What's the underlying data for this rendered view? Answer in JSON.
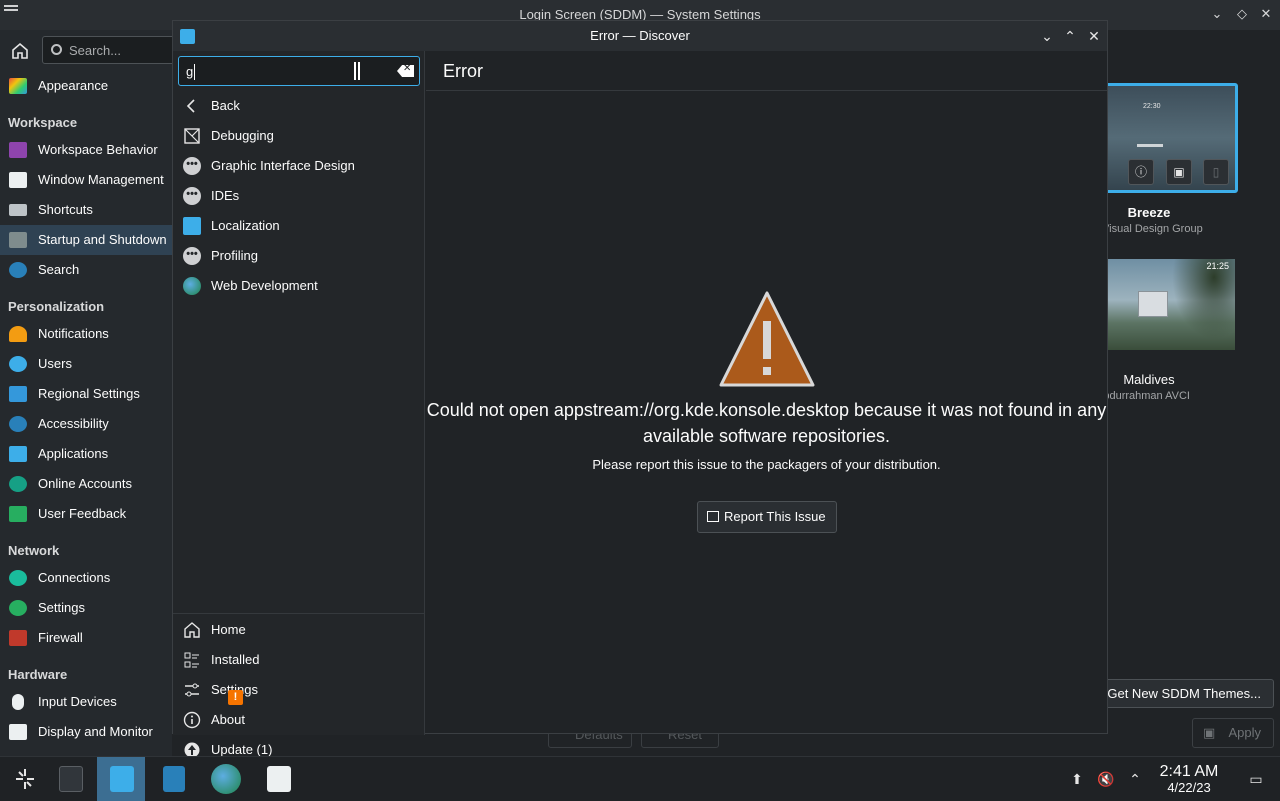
{
  "bg_window": {
    "title": "Login Screen (SDDM) — System Settings",
    "search_placeholder": "Search...",
    "sidebar": {
      "appearance": "Appearance",
      "workspace_header": "Workspace",
      "workspace_behavior": "Workspace Behavior",
      "window_management": "Window Management",
      "shortcuts": "Shortcuts",
      "startup": "Startup and Shutdown",
      "search": "Search",
      "personalization_header": "Personalization",
      "notifications": "Notifications",
      "users": "Users",
      "regional": "Regional Settings",
      "accessibility": "Accessibility",
      "applications": "Applications",
      "online_accounts": "Online Accounts",
      "user_feedback": "User Feedback",
      "network_header": "Network",
      "connections": "Connections",
      "net_settings": "Settings",
      "firewall": "Firewall",
      "hardware_header": "Hardware",
      "input_devices": "Input Devices",
      "display": "Display and Monitor"
    },
    "themes": [
      {
        "name": "Breeze",
        "author": "Visual Design Group",
        "clock": "22:30"
      },
      {
        "name": "Maldives",
        "author": "Abdurrahman AVCI",
        "clock": "21:25"
      }
    ],
    "get_new_label": "Get New SDDM Themes...",
    "apply_label": "Apply",
    "defaults_label": "Defaults",
    "reset_label": "Reset"
  },
  "discover": {
    "title": "Error — Discover",
    "search_value": "g",
    "nav": {
      "back": "Back",
      "categories": [
        "Debugging",
        "Graphic Interface Design",
        "IDEs",
        "Localization",
        "Profiling",
        "Web Development"
      ],
      "home": "Home",
      "installed": "Installed",
      "settings": "Settings",
      "about": "About",
      "update": "Update (1)",
      "update_badge": "!"
    },
    "page_title": "Error",
    "error_message": "Could not open appstream://org.kde.konsole.desktop because it was not found in any available software repositories.",
    "error_hint": "Please report this issue to the packagers of your distribution.",
    "report_label": "Report This Issue"
  },
  "taskbar": {
    "time": "2:41 AM",
    "date": "4/22/23",
    "apps": [
      "application-launcher",
      "system-settings",
      "discover",
      "dolphin",
      "browser",
      "kdeconnect"
    ]
  },
  "colors": {
    "accent": "#3daee9",
    "warning": "#f67400",
    "selection": "#2f4253"
  }
}
